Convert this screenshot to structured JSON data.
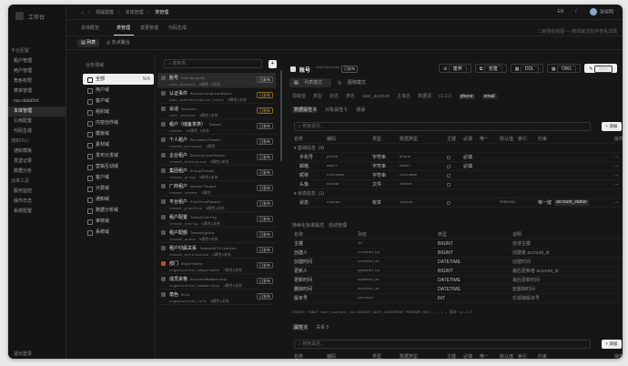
{
  "app": {
    "title": "工作台",
    "logout": "退出登录"
  },
  "sidebar": {
    "items": [
      {
        "label": "平台配置",
        "group": true
      },
      {
        "label": "租户管理"
      },
      {
        "label": "用户管理"
      },
      {
        "label": "角色权限"
      },
      {
        "label": "菜单管理"
      },
      {
        "label": "nav.dataDict"
      },
      {
        "label": "本体管理",
        "selected": true
      },
      {
        "label": "引用配置"
      },
      {
        "label": "代码生成"
      },
      {
        "label": "通知中心",
        "group": true
      },
      {
        "label": "通知模板"
      },
      {
        "label": "发送记录"
      },
      {
        "label": "数据分析"
      },
      {
        "label": "运维工具",
        "group": true
      },
      {
        "label": "服务监控"
      },
      {
        "label": "操作日志"
      },
      {
        "label": "系统配置"
      }
    ]
  },
  "topbar": {
    "breadcrumb": [
      "领域建模",
      "本体管理",
      "类管理"
    ],
    "lang": "EN",
    "user": "张晓明"
  },
  "tabs": {
    "items": [
      "本体概览",
      "类管理",
      "变更管理",
      "代码生成"
    ],
    "hint": "二级导航视图 — 按领域浏览并查看详情"
  },
  "subbar": {
    "list": "列表",
    "relation": "非点聚合"
  },
  "domains": {
    "title": "业务领域",
    "items": [
      {
        "label": "全部",
        "count": "N/A",
        "selected": true
      },
      {
        "label": "用户域"
      },
      {
        "label": "客户域"
      },
      {
        "label": "组织域"
      },
      {
        "label": "内容创作域"
      },
      {
        "label": "模板域"
      },
      {
        "label": "素材域"
      },
      {
        "label": "发布分发域"
      },
      {
        "label": "营销互动域"
      },
      {
        "label": "客户域"
      },
      {
        "label": "计费域"
      },
      {
        "label": "通知域"
      },
      {
        "label": "数据分析域"
      },
      {
        "label": "审核域"
      },
      {
        "label": "系统域"
      }
    ]
  },
  "entities": {
    "search_placeholder": "搜索类...",
    "plus": "+",
    "items": [
      {
        "name": "账号",
        "en": "UserAccount",
        "code": "user_account",
        "sub": "6属性 5关系",
        "status": "已发布",
        "selected": true
      },
      {
        "name": "认证事件",
        "en": "AuthenticationEvent",
        "code": "user_authentication_event",
        "sub": "3属性1关系",
        "status": "已发布"
      },
      {
        "name": "会话",
        "en": "Session",
        "code": "user_session",
        "sub": "3属性1关系",
        "status": "已发布"
      },
      {
        "name": "租户（储备茶类）",
        "en": "Tenant",
        "code": "tenant",
        "sub": "10属性 5关系",
        "status": "已发布"
      },
      {
        "name": "个人租户",
        "en": "PersonalTenant",
        "code": "tenant_personal",
        "sub": "1属性",
        "status": "已发布"
      },
      {
        "name": "企业租户",
        "en": "EnterpriseTenant",
        "code": "tenant_enterprise",
        "sub": "9属性2关系",
        "status": "已发布"
      },
      {
        "name": "集团租户",
        "en": "GroupTenant",
        "code": "tenant_group",
        "sub": "3属性1关系",
        "status": "已发布"
      },
      {
        "name": "厂商租户",
        "en": "VendorTenant",
        "code": "tenant_vendor",
        "sub": "5属性",
        "status": "已发布"
      },
      {
        "name": "平台租户",
        "en": "PlatformTenant",
        "code": "tenant_platform",
        "sub": "3属性1关系",
        "status": "已发布"
      },
      {
        "name": "租户配置",
        "en": "TenantConfig",
        "code": "tenant_config",
        "sub": "5属性1关系",
        "status": "已发布"
      },
      {
        "name": "租户配额",
        "en": "TenantQuota",
        "code": "tenant_quota",
        "sub": "6属性1关系",
        "status": "已发布"
      },
      {
        "name": "租户归属关系",
        "en": "TenantAffiliation",
        "code": "tenant_affiliation",
        "sub": "4属性2关系",
        "status": "已发布"
      },
      {
        "name": "部门",
        "en": "Department",
        "code": "organization_department",
        "sub": "7属性2关系",
        "status": "已发布",
        "warn": true
      },
      {
        "name": "成员资格",
        "en": "AccountMembership",
        "code": "organization_membership",
        "sub": "4属性2关系",
        "status": "已发布"
      },
      {
        "name": "角色",
        "en": "Role",
        "code": "organization_role",
        "sub": "4属性1关系",
        "status": "已发布"
      }
    ]
  },
  "detail": {
    "title": "账号",
    "en": "UserAccount",
    "status": "已发布",
    "buttons": [
      "废弃",
      "克隆",
      "DDL",
      "OWL",
      "编辑"
    ],
    "modes": [
      "列表模式",
      "图谱模式"
    ],
    "meta": {
      "labels": [
        "领域值",
        "类型",
        "状态",
        "表名"
      ],
      "values": [
        "用户域",
        "实体类",
        "已发布",
        "user_account"
      ],
      "labels2": [
        "主域名",
        "数据源"
      ],
      "version": "v1.2.0",
      "tags": [
        "phone",
        "email"
      ]
    },
    "ftabs": [
      "数据属性 8",
      "对象属性 5",
      "继承"
    ],
    "search_placeholder": "搜索属性...",
    "add": "+ 添加",
    "cols": [
      "名称",
      "编码",
      "类型",
      "数据类型",
      "主键",
      "必填",
      "唯一",
      "默认值",
      "索引",
      "约束",
      "操作"
    ],
    "groups": [
      {
        "label": "基础信息",
        "count": "(4)",
        "rows": [
          {
            "name": "手机号",
            "code": "phone",
            "type": "字符串",
            "dtype": "phone",
            "req": "✓",
            "uniq": "必填"
          },
          {
            "name": "邮箱",
            "code": "email",
            "type": "字符串",
            "dtype": "email",
            "req": "✓",
            "uniq": "必填"
          },
          {
            "name": "昵称",
            "code": "nickname",
            "type": "字符串",
            "dtype": "nickname",
            "req": "",
            "uniq": ""
          },
          {
            "name": "头像",
            "code": "avatar",
            "type": "文件",
            "dtype": "avatar",
            "req": "",
            "uniq": ""
          }
        ]
      },
      {
        "label": "状态信息",
        "count": "(1)",
        "rows": [
          {
            "name": "状态",
            "code": "status",
            "type": "枚举",
            "dtype": "status",
            "req": "",
            "uniq": "",
            "def": "PENDING",
            "idx": "唯一键",
            "cons": "account_status"
          }
        ]
      }
    ],
    "sys_title": "持续化标准属性",
    "sys_note": "自动管理",
    "sys_cols": [
      "名称",
      "列名",
      "类型",
      "说明"
    ],
    "sys_rows": [
      {
        "name": "主键",
        "col": "id",
        "type": "BIGINT",
        "desc": "自增主键"
      },
      {
        "name": "创建人",
        "col": "created_by",
        "type": "BIGINT",
        "desc": "创建者 account_id"
      },
      {
        "name": "创建时间",
        "col": "created_at",
        "type": "DATETIME",
        "desc": "创建时间"
      },
      {
        "name": "更新人",
        "col": "updated_by",
        "type": "BIGINT",
        "desc": "最后更新者 account_id"
      },
      {
        "name": "更新时间",
        "col": "updated_at",
        "type": "DATETIME",
        "desc": "最后更新时间"
      },
      {
        "name": "删除时间",
        "col": "deleted_at",
        "type": "DATETIME",
        "desc": "软删除时间"
      },
      {
        "name": "版本号",
        "col": "version",
        "type": "INT",
        "desc": "乐观锁版本号"
      }
    ],
    "ddl": "CREATE TABLE user_account (id BIGINT AUTO_INCREMENT PRIMARY KEY, ...) — 版本 v1.2.0",
    "ftabs2": [
      "属性 8",
      "关系 5"
    ],
    "search2_placeholder": "搜索属性...",
    "add2": "+ 添加",
    "cols2": [
      "名称",
      "编码",
      "类型",
      "数据类型",
      "主键",
      "必填",
      "唯一",
      "默认值",
      "索引",
      "约束",
      "操作"
    ]
  }
}
